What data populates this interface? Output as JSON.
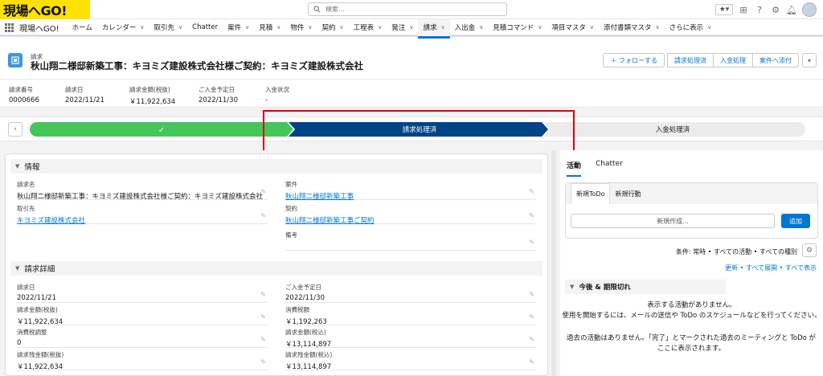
{
  "logo": {
    "text": "現場へGO!"
  },
  "search": {
    "placeholder": "検索..."
  },
  "nav": {
    "app_name": "現場へGO!",
    "items": [
      {
        "label": "ホーム",
        "chev": false
      },
      {
        "label": "カレンダー",
        "chev": true
      },
      {
        "label": "取引先",
        "chev": true
      },
      {
        "label": "Chatter",
        "chev": false
      },
      {
        "label": "案件",
        "chev": true
      },
      {
        "label": "見積",
        "chev": true
      },
      {
        "label": "物件",
        "chev": true
      },
      {
        "label": "契約",
        "chev": true
      },
      {
        "label": "工程表",
        "chev": true
      },
      {
        "label": "発注",
        "chev": true
      },
      {
        "label": "請求",
        "chev": true,
        "active": true
      },
      {
        "label": "入出金",
        "chev": true
      },
      {
        "label": "見積コマンド",
        "chev": true
      },
      {
        "label": "項目マスタ",
        "chev": true
      },
      {
        "label": "添付書類マスタ",
        "chev": true
      },
      {
        "label": "さらに表示",
        "chev": true
      }
    ]
  },
  "record": {
    "type": "請求",
    "title": "秋山翔二様邸新築工事：キヨミズ建設株式会社様ご契約：キヨミズ建設株式会社",
    "buttons": {
      "follow": "＋ フォローする",
      "b1": "請求処理済",
      "b2": "入金処理",
      "b3": "案件へ添付"
    }
  },
  "highlights": [
    {
      "label": "請求番号",
      "value": "0000666"
    },
    {
      "label": "請求日",
      "value": "2022/11/21"
    },
    {
      "label": "請求金額(税抜)",
      "value": "￥11,922,634"
    },
    {
      "label": "ご入金予定日",
      "value": "2022/11/30"
    },
    {
      "label": "入金状況",
      "value": "-"
    }
  ],
  "path": {
    "stage1": "✓",
    "stage2": "請求処理済",
    "stage3": "入金処理済",
    "colors": {
      "done": "#45c65a",
      "current": "#014486",
      "todo": "#ecebea"
    }
  },
  "info": {
    "section_title": "情報",
    "fields": {
      "name_l": "請求名",
      "name_v": "秋山翔二様邸新築工事：キヨミズ建設株式会社様ご契約：キヨミズ建設株式会社",
      "anken_l": "案件",
      "anken_v": "秋山翔二様邸新築工事",
      "torihiki_l": "取引先",
      "torihiki_v": "キヨミズ建設株式会社",
      "keiyaku_l": "契約",
      "keiyaku_v": "秋山翔二様邸新築工事ご契約",
      "biko_l": "備考",
      "biko_v": ""
    }
  },
  "detail": {
    "section_title": "請求詳細",
    "fields": {
      "date_l": "請求日",
      "date_v": "2022/11/21",
      "due_l": "ご入金予定日",
      "due_v": "2022/11/30",
      "amt_l": "請求金額(税抜)",
      "amt_v": "￥11,922,634",
      "tax_l": "消費税額",
      "tax_v": "￥1,192,263",
      "adj_l": "消費税調整",
      "adj_v": "0",
      "amtin_l": "請求金額(税込)",
      "amtin_v": "￥13,114,897",
      "rem_l": "請求残金額(税抜)",
      "rem_v": "￥11,922,634",
      "remin_l": "請求残金額(税込)",
      "remin_v": "￥13,114,897"
    }
  },
  "activity": {
    "tab_activity": "活動",
    "tab_chatter": "Chatter",
    "subtab1": "新規ToDo",
    "subtab2": "新規行動",
    "new_placeholder": "新規作成...",
    "add_label": "追加",
    "filter": "条件: 常時 • すべての活動 • すべての種別",
    "links": "更新 • すべて展開 • すべて表示",
    "upcoming": "今後 & 期限切れ",
    "none1": "表示する活動がありません。",
    "none2": "使用を開始するには、メールの送信や ToDo のスケジュールなどを行ってください。",
    "past": "過去の活動はありません。「完了」とマークされた過去のミーティングと ToDo がここに表示されます。"
  }
}
